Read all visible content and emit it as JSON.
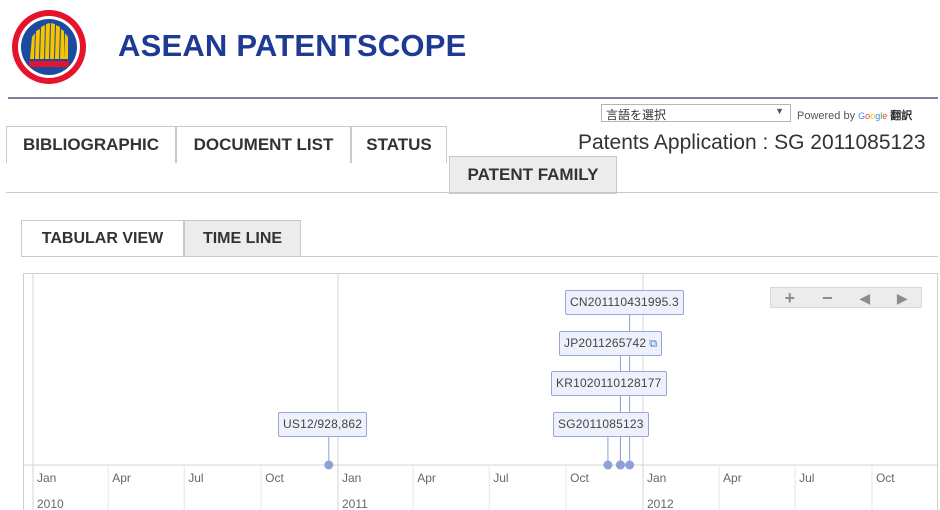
{
  "header": {
    "site_title": "ASEAN PATENTSCOPE"
  },
  "translate": {
    "select_value": "言語を選択",
    "powered_by": "Powered by",
    "google": [
      "G",
      "o",
      "o",
      "g",
      "l",
      "e"
    ],
    "translate_label": "翻訳"
  },
  "app_title": "Patents Application : SG 2011085123",
  "main_tabs": {
    "bibliographic": "BIBLIOGRAPHIC",
    "document_list": "DOCUMENT LIST",
    "status": "STATUS",
    "patent_family": "PATENT FAMILY"
  },
  "view_tabs": {
    "tabular_view": "TABULAR VIEW",
    "time_line": "TIME LINE"
  },
  "timeline_controls": {
    "zoom_in": "+",
    "zoom_out": "−",
    "prev": "◀",
    "next": "▶"
  },
  "timeline": {
    "range_start": "2010-01-01",
    "range_end": "2012-12-31",
    "month_ticks": [
      {
        "label": "Jan",
        "year": "2010",
        "date": "2010-01-01"
      },
      {
        "label": "Apr",
        "year": "",
        "date": "2010-04-01"
      },
      {
        "label": "Jul",
        "year": "",
        "date": "2010-07-01"
      },
      {
        "label": "Oct",
        "year": "",
        "date": "2010-10-01"
      },
      {
        "label": "Jan",
        "year": "2011",
        "date": "2011-01-01"
      },
      {
        "label": "Apr",
        "year": "",
        "date": "2011-04-01"
      },
      {
        "label": "Jul",
        "year": "",
        "date": "2011-07-01"
      },
      {
        "label": "Oct",
        "year": "",
        "date": "2011-10-01"
      },
      {
        "label": "Jan",
        "year": "2012",
        "date": "2012-01-01"
      },
      {
        "label": "Apr",
        "year": "",
        "date": "2012-04-01"
      },
      {
        "label": "Jul",
        "year": "",
        "date": "2012-07-01"
      },
      {
        "label": "Oct",
        "year": "",
        "date": "2012-10-01"
      }
    ],
    "events": [
      {
        "label": "US12/928,862",
        "date": "2010-12-21",
        "external_link": false
      },
      {
        "label": "SG2011085123",
        "date": "2011-11-20",
        "external_link": false
      },
      {
        "label": "KR1020110128177",
        "date": "2011-12-05",
        "external_link": false
      },
      {
        "label": "JP2011265742",
        "date": "2011-12-05",
        "external_link": true
      },
      {
        "label": "CN201110431995.3",
        "date": "2011-12-16",
        "external_link": false
      }
    ]
  }
}
